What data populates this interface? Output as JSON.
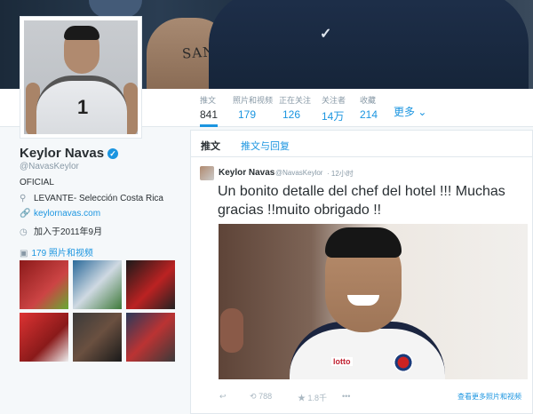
{
  "banner": {
    "tattoo_text": "SANZ"
  },
  "nav": {
    "stats": [
      {
        "label": "推文",
        "value": "841"
      },
      {
        "label": "照片和视频",
        "value": "179"
      },
      {
        "label": "正在关注",
        "value": "126"
      },
      {
        "label": "关注者",
        "value": "14万"
      },
      {
        "label": "收藏",
        "value": "214"
      }
    ],
    "more_label": "更多"
  },
  "profile": {
    "name": "Keylor Navas",
    "handle": "@NavasKeylor",
    "bio": "OFICIAL",
    "location": "LEVANTE- Selección Costa Rica",
    "website": "keylornavas.com",
    "joined": "加入于2011年9月",
    "media_label": "179 照片和视频"
  },
  "timeline": {
    "tabs": [
      {
        "label": "推文"
      },
      {
        "label": "推文与回复"
      }
    ],
    "tweet": {
      "author": "Keylor Navas",
      "handle": "@NavasKeylor",
      "time": "12小时",
      "text": "Un bonito detalle del chef del hotel !!! Muchas gracias !!muito obrigado !!",
      "photo_logo": "lotto",
      "retweets": "788",
      "favorites": "1.8千",
      "more_link": "查看更多照片和视频"
    }
  },
  "colors": {
    "accent": "#1b95e0",
    "text": "#292f33",
    "muted": "#8899a6"
  }
}
